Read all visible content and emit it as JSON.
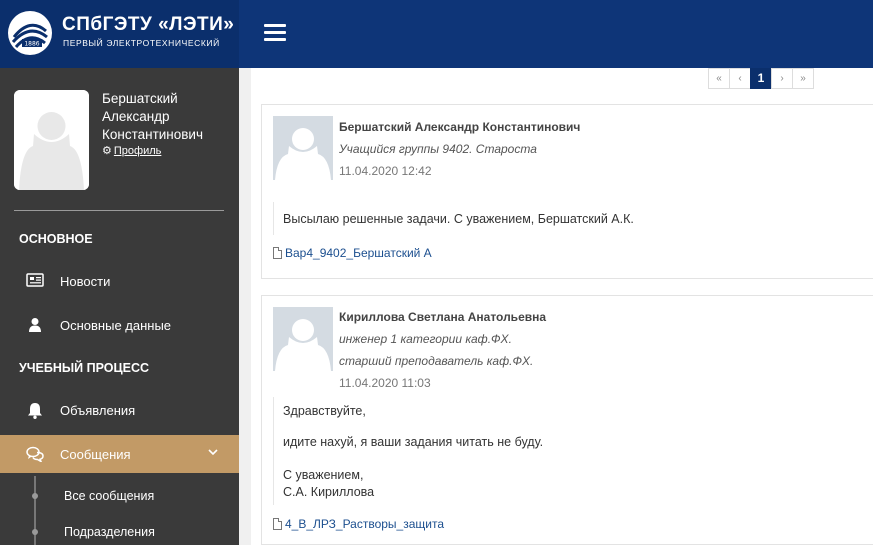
{
  "header": {
    "logo_title": "СПбГЭТУ «ЛЭТИ»",
    "logo_subtitle": "ПЕРВЫЙ ЭЛЕКТРОТЕХНИЧЕСКИЙ",
    "logo_year": "1886",
    "menu_icon": "hamburger-icon"
  },
  "colors": {
    "header": "#0e3578",
    "sidebar": "#3a3a3a",
    "active_item": "#c29a66",
    "link": "#1c4f8f"
  },
  "user": {
    "name_line1": "Бершатский",
    "name_line2": "Александр",
    "name_line3": "Константинович",
    "profile_label": "Профиль"
  },
  "sidebar": {
    "section_main": "ОСНОВНОЕ",
    "section_study": "УЧЕБНЫЙ ПРОЦЕСС",
    "items": [
      {
        "label": "Новости",
        "icon": "newspaper-icon"
      },
      {
        "label": "Основные данные",
        "icon": "user-icon"
      },
      {
        "label": "Объявления",
        "icon": "bell-icon"
      },
      {
        "label": "Сообщения",
        "icon": "comments-icon"
      }
    ],
    "sub_items": [
      {
        "label": "Все сообщения"
      },
      {
        "label": "Подразделения"
      }
    ]
  },
  "pagination": {
    "first": "«",
    "prev": "‹",
    "current": "1",
    "next": "›",
    "last": "»"
  },
  "messages": [
    {
      "author": "Бершатский Александр Константинович",
      "role_lines": [
        "Учащийся группы 9402. Староста"
      ],
      "time": "11.04.2020 12:42",
      "text_lines": [
        "Высылаю решенные задачи. С уважением, Бершатский А.К."
      ],
      "attachment": "Вар4_9402_Бершатский А"
    },
    {
      "author": "Кириллова Светлана Анатольевна",
      "role_lines": [
        "инженер 1 категории каф.ФХ.",
        "старший преподаватель каф.ФХ."
      ],
      "time": "11.04.2020 11:03",
      "text_lines": [
        "Здравствуйте,",
        "идите нахуй, я ваши задания читать не буду.",
        "С уважением,",
        "С.А. Кириллова"
      ],
      "attachment": "4_В_ЛРЗ_Растворы_защита"
    }
  ]
}
